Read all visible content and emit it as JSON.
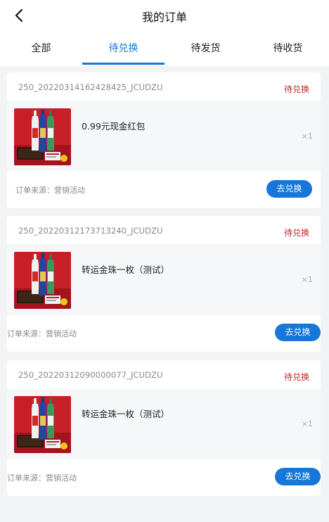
{
  "header": {
    "title": "我的订单",
    "back_icon": "chevron-left-icon"
  },
  "tabs": [
    {
      "label": "全部",
      "active": false
    },
    {
      "label": "待兑换",
      "active": true
    },
    {
      "label": "待发货",
      "active": false
    },
    {
      "label": "待收货",
      "active": false
    }
  ],
  "colors": {
    "accent": "#1677d9",
    "status": "#c8252c",
    "background": "#f2f3f5"
  },
  "orders": [
    {
      "order_no": "250_20220314162428425_JCUDZU",
      "status": "待兑换",
      "item_name": "0.99元现金红包",
      "quantity": "×1",
      "source": "订单来源：营销活动",
      "action": "去兑换"
    },
    {
      "order_no": "250_20220312173713240_JCUDZU",
      "status": "待兑换",
      "item_name": "转运金珠一枚（测试）",
      "quantity": "×1",
      "source": "订单来源：营销活动",
      "action": "去兑换"
    },
    {
      "order_no": "250_20220312090000077_JCUDZU",
      "status": "待兑换",
      "item_name": "转运金珠一枚（测试）",
      "quantity": "×1",
      "source": "订单来源：营销活动",
      "action": "去兑换"
    }
  ]
}
